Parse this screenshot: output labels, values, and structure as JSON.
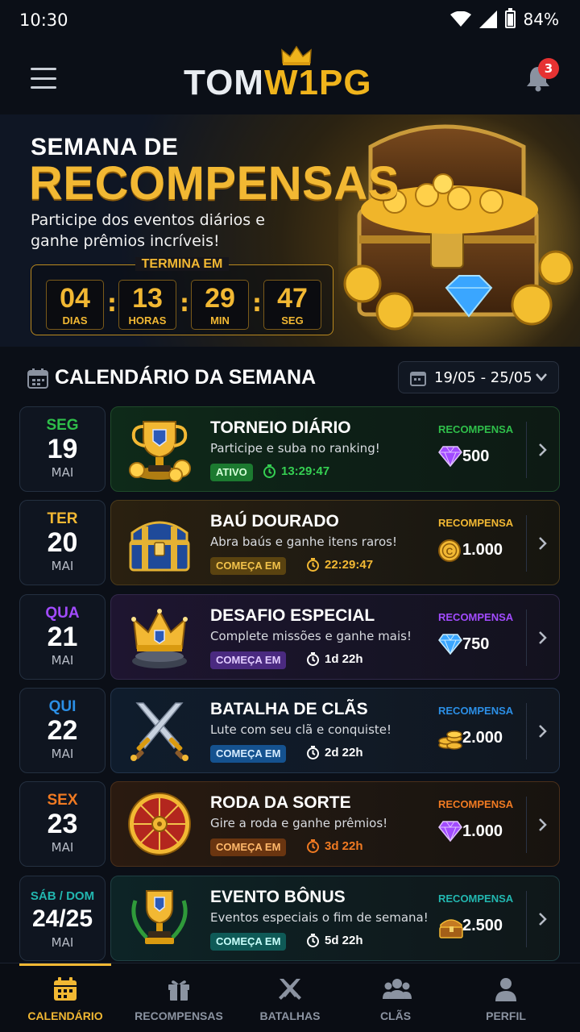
{
  "status_bar": {
    "time": "10:30",
    "battery": "84%"
  },
  "header": {
    "logo_part1": "TOM",
    "logo_part2": "W1PG",
    "notification_count": "3"
  },
  "banner": {
    "title_line1": "SEMANA DE",
    "title_line2": "RECOMPENSAS",
    "subtitle": "Participe dos eventos diários e ganhe prêmios incríveis!",
    "countdown_label": "TERMINA EM",
    "countdown": [
      {
        "value": "04",
        "unit": "DIAS"
      },
      {
        "value": "13",
        "unit": "HORAS"
      },
      {
        "value": "29",
        "unit": "MIN"
      },
      {
        "value": "47",
        "unit": "SEG"
      }
    ]
  },
  "calendar": {
    "title": "CALENDÁRIO DA SEMANA",
    "range": "19/05 - 25/05"
  },
  "events": [
    {
      "day": "SEG",
      "date": "19",
      "month": "MAI",
      "title": "TORNEIO DIÁRIO",
      "desc": "Participe e suba no ranking!",
      "badge": "ATIVO",
      "timer": "13:29:47",
      "reward_label": "RECOMPENSA",
      "reward_value": "500",
      "reward_icon": "gem-icon",
      "accent": "#2fbf4a"
    },
    {
      "day": "TER",
      "date": "20",
      "month": "MAI",
      "title": "BAÚ DOURADO",
      "desc": "Abra baús e ganhe itens raros!",
      "badge": "COMEÇA EM",
      "timer": "22:29:47",
      "reward_label": "RECOMPENSA",
      "reward_value": "1.000",
      "reward_icon": "coin-icon",
      "accent": "#f2b833"
    },
    {
      "day": "QUA",
      "date": "21",
      "month": "MAI",
      "title": "DESAFIO ESPECIAL",
      "desc": "Complete missões e ganhe mais!",
      "badge": "COMEÇA EM",
      "timer": "1d 22h",
      "reward_label": "RECOMPENSA",
      "reward_value": "750",
      "reward_icon": "diamond-icon",
      "accent": "#a24bff"
    },
    {
      "day": "QUI",
      "date": "22",
      "month": "MAI",
      "title": "BATALHA DE CLÃS",
      "desc": "Lute com seu clã e conquiste!",
      "badge": "COMEÇA EM",
      "timer": "2d 22h",
      "reward_label": "RECOMPENSA",
      "reward_value": "2.000",
      "reward_icon": "coins-stack-icon",
      "accent": "#2b8fe6"
    },
    {
      "day": "SEX",
      "date": "23",
      "month": "MAI",
      "title": "RODA DA SORTE",
      "desc": "Gire a roda e ganhe prêmios!",
      "badge": "COMEÇA EM",
      "timer": "3d 22h",
      "reward_label": "RECOMPENSA",
      "reward_value": "1.000",
      "reward_icon": "gem-icon",
      "accent": "#f07a22"
    },
    {
      "day": "SÁB / DOM",
      "date": "24/25",
      "month": "MAI",
      "title": "EVENTO BÔNUS",
      "desc": "Eventos especiais o fim de semana!",
      "badge": "COMEÇA EM",
      "timer": "5d 22h",
      "reward_label": "RECOMPENSA",
      "reward_value": "2.500",
      "reward_icon": "chest-icon",
      "accent": "#22b7b0"
    }
  ],
  "nav": [
    {
      "label": "CALENDÁRIO",
      "icon": "calendar-icon",
      "active": true
    },
    {
      "label": "RECOMPENSAS",
      "icon": "gift-icon"
    },
    {
      "label": "BATALHAS",
      "icon": "swords-icon"
    },
    {
      "label": "CLÃS",
      "icon": "group-icon"
    },
    {
      "label": "PERFIL",
      "icon": "person-icon"
    }
  ],
  "colors": {
    "gold": "#f2b833",
    "background": "#0b0f17",
    "card_border": "#243040"
  }
}
